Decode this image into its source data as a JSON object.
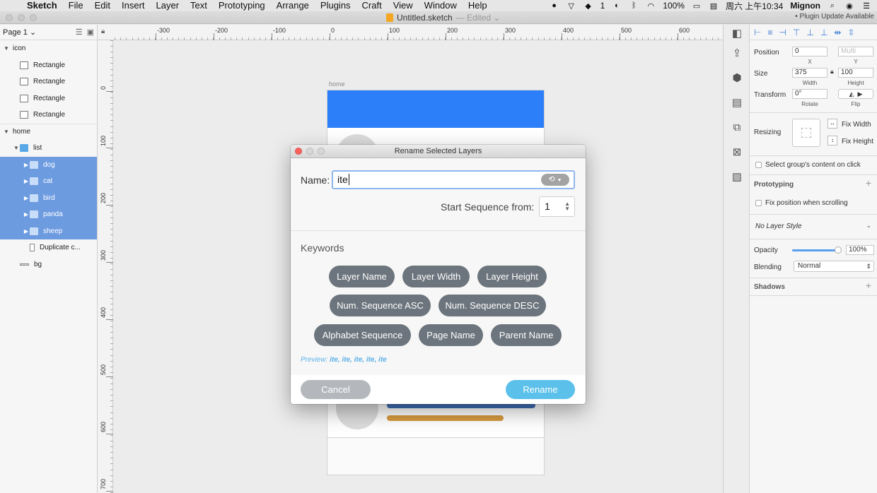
{
  "menubar": {
    "app": "Sketch",
    "items": [
      "File",
      "Edit",
      "Insert",
      "Layer",
      "Text",
      "Prototyping",
      "Arrange",
      "Plugins",
      "Craft",
      "View",
      "Window",
      "Help"
    ],
    "status": {
      "notifications": "1",
      "battery": "100%",
      "clock": "周六 上午10:34",
      "user": "Mignon"
    }
  },
  "window": {
    "doc_title": "Untitled.sketch",
    "edited": "— Edited ⌄",
    "plugin_notice": "• Plugin Update Available"
  },
  "layers": {
    "page": "Page 1 ⌄",
    "rows": [
      {
        "label": "icon",
        "indent": 0,
        "icon": "none",
        "arrow": "▼",
        "selected": false,
        "group": false
      },
      {
        "label": "Rectangle",
        "indent": 1,
        "icon": "rect",
        "arrow": "",
        "selected": false,
        "group": false
      },
      {
        "label": "Rectangle",
        "indent": 1,
        "icon": "rect",
        "arrow": "",
        "selected": false,
        "group": false
      },
      {
        "label": "Rectangle",
        "indent": 1,
        "icon": "rect",
        "arrow": "",
        "selected": false,
        "group": false
      },
      {
        "label": "Rectangle",
        "indent": 1,
        "icon": "rect",
        "arrow": "",
        "selected": false,
        "group": false
      },
      {
        "label": "home",
        "indent": 0,
        "icon": "none",
        "arrow": "▼",
        "selected": false,
        "group": true
      },
      {
        "label": "list",
        "indent": 1,
        "icon": "folder",
        "arrow": "▼",
        "selected": false,
        "group": false
      },
      {
        "label": "dog",
        "indent": 2,
        "icon": "folder",
        "arrow": "▶",
        "selected": true,
        "group": false
      },
      {
        "label": "cat",
        "indent": 2,
        "icon": "folder",
        "arrow": "▶",
        "selected": true,
        "group": false
      },
      {
        "label": "bird",
        "indent": 2,
        "icon": "folder",
        "arrow": "▶",
        "selected": true,
        "group": false
      },
      {
        "label": "panda",
        "indent": 2,
        "icon": "folder",
        "arrow": "▶",
        "selected": true,
        "group": false
      },
      {
        "label": "sheep",
        "indent": 2,
        "icon": "folder",
        "arrow": "▶",
        "selected": true,
        "group": false
      },
      {
        "label": "Duplicate c...",
        "indent": 2,
        "icon": "doc",
        "arrow": "",
        "selected": false,
        "group": false
      },
      {
        "label": "bg",
        "indent": 1,
        "icon": "line",
        "arrow": "",
        "selected": false,
        "group": false
      }
    ]
  },
  "rulers": {
    "top": [
      "-300",
      "-200",
      "-100",
      "0",
      "100",
      "200",
      "300",
      "400",
      "500",
      "600"
    ],
    "left": [
      "0",
      "100",
      "200",
      "300",
      "400",
      "500",
      "600",
      "700"
    ]
  },
  "canvas": {
    "artboard_label": "home"
  },
  "inspector": {
    "position_label": "Position",
    "x_value": "0",
    "y_placeholder": "Multi",
    "x_caption": "X",
    "y_caption": "Y",
    "size_label": "Size",
    "width_value": "375",
    "height_value": "100",
    "width_caption": "Width",
    "height_caption": "Height",
    "transform_label": "Transform",
    "rotate_value": "0°",
    "rotate_caption": "Rotate",
    "flip_caption": "Flip",
    "resizing_label": "Resizing",
    "fix_width": "Fix Width",
    "fix_height": "Fix Height",
    "select_group": "Select group's content on click",
    "prototyping_title": "Prototyping",
    "fix_position": "Fix position when scrolling",
    "layer_style": "No Layer Style",
    "opacity_label": "Opacity",
    "opacity_value": "100%",
    "opacity_level": 1.0,
    "blending_label": "Blending",
    "blending_value": "Normal",
    "shadows_title": "Shadows"
  },
  "dialog": {
    "title": "Rename Selected Layers",
    "name_label": "Name:",
    "name_value": "ite",
    "start_label": "Start Sequence from:",
    "start_value": "1",
    "keywords_title": "Keywords",
    "keywords": [
      "Layer Name",
      "Layer Width",
      "Layer Height",
      "Num. Sequence ASC",
      "Num. Sequence DESC",
      "Alphabet Sequence",
      "Page Name",
      "Parent Name"
    ],
    "preview_label": "Preview:",
    "preview_value": "ite, ite, ite, ite, ite",
    "cancel": "Cancel",
    "rename": "Rename"
  },
  "colors": {
    "accent_blue": "#2d7ff9",
    "selection": "#6d9be0",
    "rename_button": "#5bc0ea",
    "chip": "#6c757d",
    "card_bar_blue": "#3f6db4",
    "card_bar_orange": "#d69a3e"
  }
}
